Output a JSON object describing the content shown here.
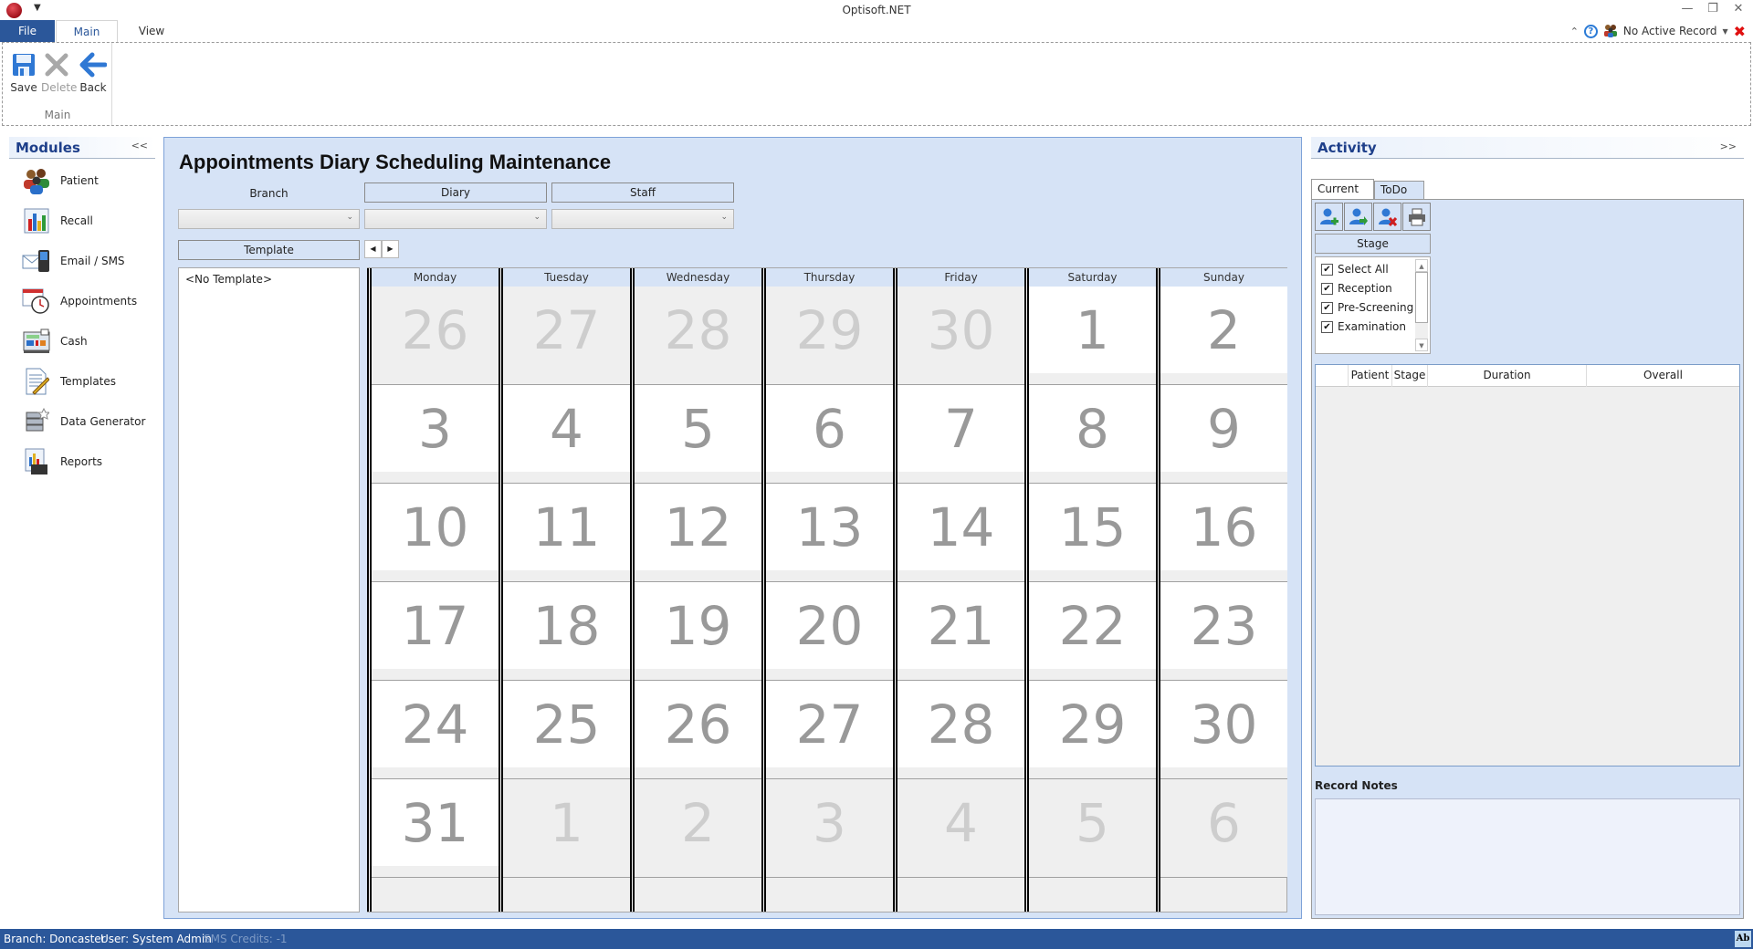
{
  "window": {
    "title": "Optisoft.NET",
    "controls": {
      "minimize": "—",
      "restore": "❐",
      "close": "✕"
    }
  },
  "ribbon": {
    "tabs": [
      {
        "label": "File"
      },
      {
        "label": "Main",
        "active": true
      },
      {
        "label": "View"
      }
    ],
    "groups": [
      {
        "label": "Main",
        "buttons": [
          {
            "label": "Save",
            "icon": "save-icon",
            "enabled": true
          },
          {
            "label": "Delete",
            "icon": "delete-icon",
            "enabled": false
          },
          {
            "label": "Back",
            "icon": "back-arrow-icon",
            "enabled": true
          }
        ]
      }
    ]
  },
  "record_status": {
    "label": "No Active Record",
    "icons": [
      "collapse-ribbon-icon",
      "help-icon",
      "patients-icon",
      "dropdown-icon",
      "close-record-icon"
    ]
  },
  "modules": {
    "title": "Modules",
    "collapse_label": "<<",
    "items": [
      {
        "label": "Patient",
        "icon": "patient-icon"
      },
      {
        "label": "Recall",
        "icon": "recall-chart-icon"
      },
      {
        "label": "Email / SMS",
        "icon": "email-sms-icon"
      },
      {
        "label": "Appointments",
        "icon": "appointments-icon"
      },
      {
        "label": "Cash",
        "icon": "cash-register-icon"
      },
      {
        "label": "Templates",
        "icon": "templates-icon"
      },
      {
        "label": "Data Generator",
        "icon": "data-generator-icon"
      },
      {
        "label": "Reports",
        "icon": "reports-icon"
      }
    ]
  },
  "main": {
    "title": "Appointments Diary Scheduling Maintenance",
    "filters": {
      "branch": {
        "label": "Branch",
        "value": ""
      },
      "diary": {
        "label": "Diary",
        "value": ""
      },
      "staff": {
        "label": "Staff",
        "value": ""
      }
    },
    "template_label": "Template",
    "nav": {
      "prev": "◀",
      "next": "▶"
    },
    "templates": [
      "<No Template>"
    ],
    "calendar": {
      "weekdays": [
        "Monday",
        "Tuesday",
        "Wednesday",
        "Thursday",
        "Friday",
        "Saturday",
        "Sunday"
      ],
      "weeks": [
        [
          {
            "d": "26",
            "cur": false
          },
          {
            "d": "27",
            "cur": false
          },
          {
            "d": "28",
            "cur": false
          },
          {
            "d": "29",
            "cur": false
          },
          {
            "d": "30",
            "cur": false
          },
          {
            "d": "1",
            "cur": true
          },
          {
            "d": "2",
            "cur": true
          }
        ],
        [
          {
            "d": "3",
            "cur": true
          },
          {
            "d": "4",
            "cur": true
          },
          {
            "d": "5",
            "cur": true
          },
          {
            "d": "6",
            "cur": true
          },
          {
            "d": "7",
            "cur": true
          },
          {
            "d": "8",
            "cur": true
          },
          {
            "d": "9",
            "cur": true
          }
        ],
        [
          {
            "d": "10",
            "cur": true
          },
          {
            "d": "11",
            "cur": true
          },
          {
            "d": "12",
            "cur": true
          },
          {
            "d": "13",
            "cur": true
          },
          {
            "d": "14",
            "cur": true
          },
          {
            "d": "15",
            "cur": true
          },
          {
            "d": "16",
            "cur": true
          }
        ],
        [
          {
            "d": "17",
            "cur": true
          },
          {
            "d": "18",
            "cur": true
          },
          {
            "d": "19",
            "cur": true
          },
          {
            "d": "20",
            "cur": true
          },
          {
            "d": "21",
            "cur": true
          },
          {
            "d": "22",
            "cur": true
          },
          {
            "d": "23",
            "cur": true
          }
        ],
        [
          {
            "d": "24",
            "cur": true
          },
          {
            "d": "25",
            "cur": true
          },
          {
            "d": "26",
            "cur": true
          },
          {
            "d": "27",
            "cur": true
          },
          {
            "d": "28",
            "cur": true
          },
          {
            "d": "29",
            "cur": true
          },
          {
            "d": "30",
            "cur": true
          }
        ],
        [
          {
            "d": "31",
            "cur": true
          },
          {
            "d": "1",
            "cur": false
          },
          {
            "d": "2",
            "cur": false
          },
          {
            "d": "3",
            "cur": false
          },
          {
            "d": "4",
            "cur": false
          },
          {
            "d": "5",
            "cur": false
          },
          {
            "d": "6",
            "cur": false
          }
        ]
      ]
    }
  },
  "activity": {
    "title": "Activity",
    "expand_label": ">>",
    "tabs": [
      {
        "label": "Current",
        "active": true
      },
      {
        "label": "ToDo"
      }
    ],
    "tools": [
      "add-patient-icon",
      "move-patient-icon",
      "remove-patient-icon",
      "print-icon"
    ],
    "stage_label": "Stage",
    "stages": [
      {
        "label": "Select All",
        "checked": true
      },
      {
        "label": "Reception",
        "checked": true
      },
      {
        "label": "Pre-Screening",
        "checked": true
      },
      {
        "label": "Examination",
        "checked": true
      }
    ],
    "grid_columns": [
      "",
      "Patient",
      "Stage",
      "Duration",
      "Overall"
    ],
    "notes_label": "Record Notes",
    "notes_value": ""
  },
  "statusbar": {
    "branch": "Branch: Doncaster",
    "user": "User: System Admin",
    "sms_credits": "SMS Credits: -1",
    "ab_label": "Ab"
  },
  "colors": {
    "accent": "#2b579a",
    "panel_bg": "#d6e3f6",
    "header_text": "#1e3f8a",
    "day_current": "#999999",
    "day_other": "#cdcdcd"
  }
}
